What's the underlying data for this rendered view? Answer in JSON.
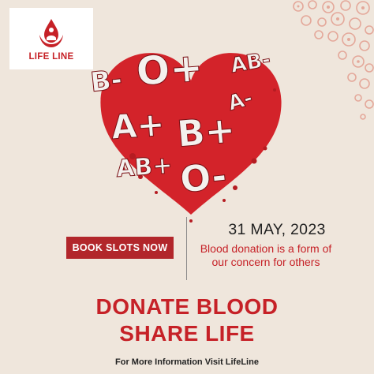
{
  "brand": {
    "name": "LIFE LINE",
    "accent": "#c62127"
  },
  "heart": {
    "blood_types": [
      "B-",
      "O+",
      "AB-",
      "A+",
      "B+",
      "A-",
      "AB+",
      "O-"
    ],
    "color": "#d3232a"
  },
  "cta": {
    "book_label": "BOOK SLOTS NOW",
    "color": "#b2262b"
  },
  "event": {
    "date": "31 MAY, 2023",
    "tagline": "Blood donation is a form of our concern for others"
  },
  "headline": {
    "line1": "DONATE BLOOD",
    "line2": "SHARE LIFE"
  },
  "footer": {
    "info": "For More Information Visit LifeLine"
  },
  "colors": {
    "background": "#efe6dc",
    "text_dark": "#222222"
  },
  "icons": [
    "blood-drop-hands-icon",
    "blood-cells-decoration"
  ]
}
